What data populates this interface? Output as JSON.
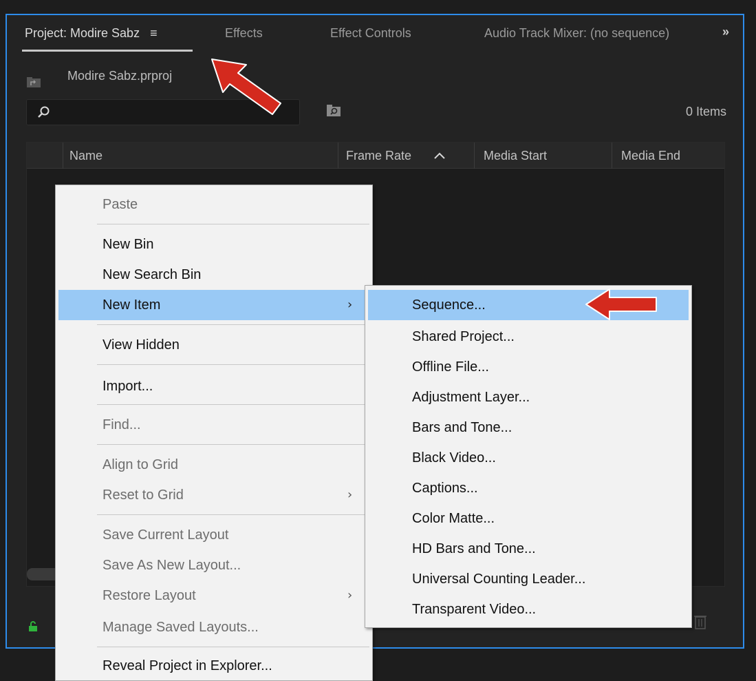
{
  "tabs": {
    "project": "Project: Modire Sabz",
    "hamburger": "≡",
    "effects": "Effects",
    "effect_controls": "Effect Controls",
    "audio_mixer": "Audio Track Mixer: (no sequence)",
    "more": "»"
  },
  "project": {
    "file_name": "Modire Sabz.prproj",
    "item_count": "0 Items"
  },
  "search": {
    "placeholder": ""
  },
  "list": {
    "columns": [
      "Name",
      "Frame Rate",
      "Media Start",
      "Media End"
    ]
  },
  "context_menu": {
    "items": [
      {
        "label": "Paste",
        "enabled": false
      },
      {
        "label": "New Bin",
        "enabled": true
      },
      {
        "label": "New Search Bin",
        "enabled": true
      },
      {
        "label": "New Item",
        "enabled": true,
        "submenu": true,
        "highlighted": true
      },
      {
        "label": "View Hidden",
        "enabled": true
      },
      {
        "label": "Import...",
        "enabled": true
      },
      {
        "label": "Find...",
        "enabled": false
      },
      {
        "label": "Align to Grid",
        "enabled": false
      },
      {
        "label": "Reset to Grid",
        "enabled": false,
        "submenu": true
      },
      {
        "label": "Save Current Layout",
        "enabled": false
      },
      {
        "label": "Save As New Layout...",
        "enabled": false
      },
      {
        "label": "Restore Layout",
        "enabled": false,
        "submenu": true
      },
      {
        "label": "Manage Saved Layouts...",
        "enabled": false
      },
      {
        "label": "Reveal Project in Explorer...",
        "enabled": true
      }
    ],
    "submenu_arrow": "›"
  },
  "new_item_submenu": {
    "items": [
      {
        "label": "Sequence...",
        "highlighted": true
      },
      {
        "label": "Shared Project..."
      },
      {
        "label": "Offline File..."
      },
      {
        "label": "Adjustment Layer..."
      },
      {
        "label": "Bars and Tone..."
      },
      {
        "label": "Black Video..."
      },
      {
        "label": "Captions..."
      },
      {
        "label": "Color Matte..."
      },
      {
        "label": "HD Bars and Tone..."
      },
      {
        "label": "Universal Counting Leader..."
      },
      {
        "label": "Transparent Video..."
      }
    ]
  },
  "colors": {
    "panel_border": "#2d8ceb",
    "menu_highlight": "#99c9f5",
    "annotation_arrow": "#d42a1e",
    "lock_icon": "#2fb43c"
  },
  "icons": [
    "folder-up-icon",
    "search-icon",
    "bin-search-icon",
    "sort-ascending-icon",
    "lock-icon",
    "trash-icon",
    "chevron-right-icon"
  ]
}
